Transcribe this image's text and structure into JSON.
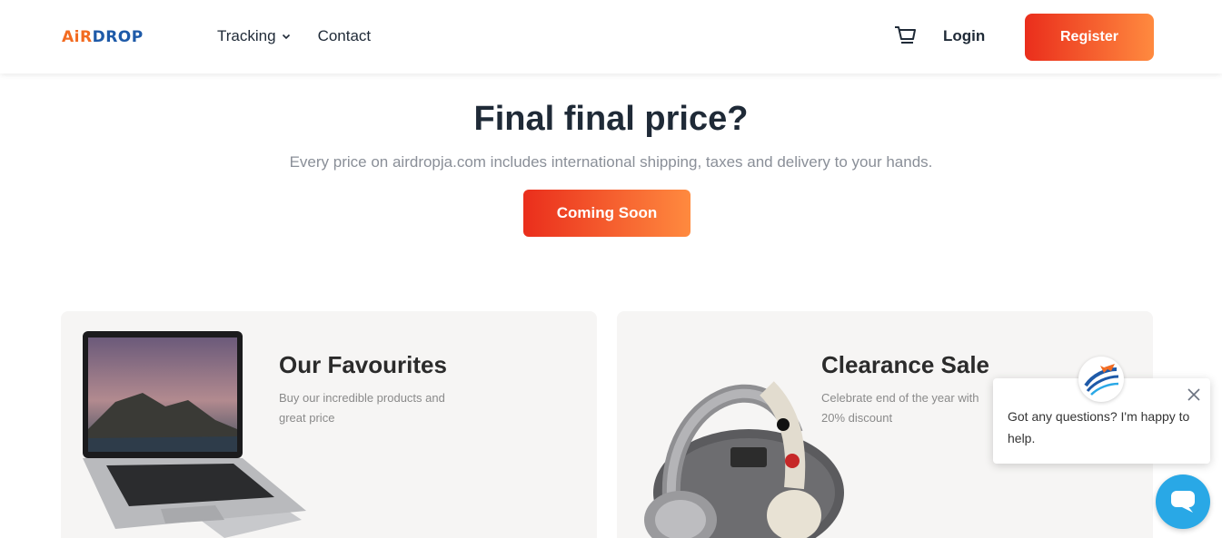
{
  "brand": {
    "logo_air": "AiR",
    "logo_drop": "DROP",
    "accent_start": "#ea2e1c",
    "accent_end": "#ff8a3f"
  },
  "nav": {
    "tracking": "Tracking",
    "contact": "Contact"
  },
  "header": {
    "login": "Login",
    "register": "Register",
    "cart_icon": "cart-icon"
  },
  "hero": {
    "title": "Final final price?",
    "subtitle": "Every price on airdropja.com includes international shipping, taxes and delivery to your hands.",
    "button": "Coming Soon"
  },
  "cards": [
    {
      "title": "Our Favourites",
      "text": "Buy our incredible products and great price"
    },
    {
      "title": "Clearance Sale",
      "text": "Celebrate end of the year with 20% discount"
    }
  ],
  "chat": {
    "message": "Got any questions? I'm happy to help."
  }
}
